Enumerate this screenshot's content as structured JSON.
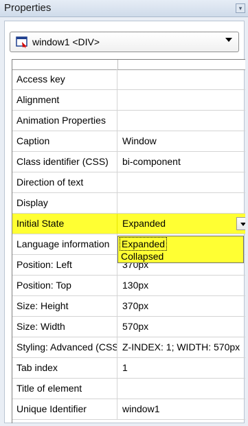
{
  "panel": {
    "title": "Properties"
  },
  "object_selector": {
    "value": "window1 <DIV>",
    "icon": "window-object-icon"
  },
  "properties": [
    {
      "name": "Access key",
      "value": ""
    },
    {
      "name": "Alignment",
      "value": ""
    },
    {
      "name": "Animation Properties",
      "value": ""
    },
    {
      "name": "Caption",
      "value": "Window"
    },
    {
      "name": "Class identifier (CSS)",
      "value": "bi-component"
    },
    {
      "name": "Direction of text",
      "value": ""
    },
    {
      "name": "Display",
      "value": ""
    },
    {
      "name": "Initial State",
      "value": "Expanded"
    },
    {
      "name": "Language information",
      "value": ""
    },
    {
      "name": "Position: Left",
      "value": "370px"
    },
    {
      "name": "Position: Top",
      "value": "130px"
    },
    {
      "name": "Size: Height",
      "value": "370px"
    },
    {
      "name": "Size: Width",
      "value": "570px"
    },
    {
      "name": "Styling: Advanced (CSS)",
      "value": "Z-INDEX: 1; WIDTH: 570px"
    },
    {
      "name": "Tab index",
      "value": "1"
    },
    {
      "name": "Title of element",
      "value": ""
    },
    {
      "name": "Unique Identifier",
      "value": "window1"
    }
  ],
  "initial_state_dropdown": {
    "options": [
      "Expanded",
      "Collapsed"
    ],
    "highlight_color": "#ffff33"
  }
}
